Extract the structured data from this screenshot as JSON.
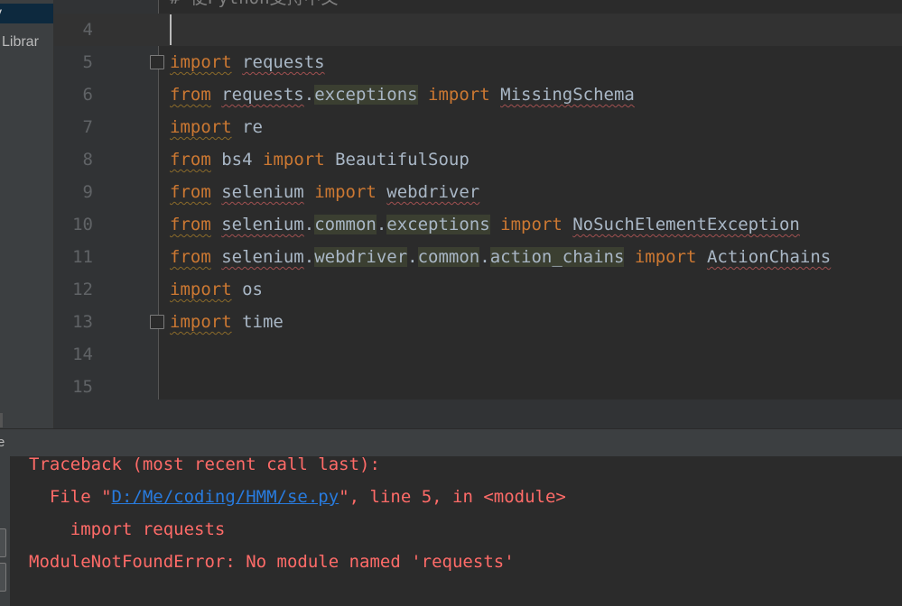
{
  "project_tree": {
    "items": [
      {
        "label": "y",
        "selected": true
      },
      {
        "label": "l Librar",
        "selected": false
      }
    ]
  },
  "editor": {
    "partial_top_line": "# 使Python支持中文",
    "current_line": 4,
    "lines": [
      {
        "num": "4",
        "tokens": []
      },
      {
        "num": "5",
        "fold": "start",
        "tokens": [
          {
            "t": "import",
            "c": "kw wavy-kw"
          },
          {
            "t": " "
          },
          {
            "t": "requests",
            "c": "wavy"
          }
        ]
      },
      {
        "num": "6",
        "tokens": [
          {
            "t": "from",
            "c": "kw wavy-kw"
          },
          {
            "t": " "
          },
          {
            "t": "requests",
            "c": "wavy"
          },
          {
            "t": "."
          },
          {
            "t": "exceptions",
            "c": "hl"
          },
          {
            "t": " "
          },
          {
            "t": "import",
            "c": "kw"
          },
          {
            "t": " "
          },
          {
            "t": "MissingSchema",
            "c": "wavy"
          }
        ]
      },
      {
        "num": "7",
        "tokens": [
          {
            "t": "import",
            "c": "kw wavy-kw"
          },
          {
            "t": " "
          },
          {
            "t": "re"
          }
        ]
      },
      {
        "num": "8",
        "tokens": [
          {
            "t": "from",
            "c": "kw wavy-kw"
          },
          {
            "t": " "
          },
          {
            "t": "bs4"
          },
          {
            "t": " "
          },
          {
            "t": "import",
            "c": "kw"
          },
          {
            "t": " "
          },
          {
            "t": "BeautifulSoup"
          }
        ]
      },
      {
        "num": "9",
        "tokens": [
          {
            "t": "from",
            "c": "kw wavy-kw"
          },
          {
            "t": " "
          },
          {
            "t": "selenium",
            "c": "wavy"
          },
          {
            "t": " "
          },
          {
            "t": "import",
            "c": "kw"
          },
          {
            "t": " "
          },
          {
            "t": "webdriver",
            "c": "wavy"
          }
        ]
      },
      {
        "num": "10",
        "tokens": [
          {
            "t": "from",
            "c": "kw wavy-kw"
          },
          {
            "t": " "
          },
          {
            "t": "selenium",
            "c": "wavy"
          },
          {
            "t": "."
          },
          {
            "t": "common",
            "c": "hl"
          },
          {
            "t": "."
          },
          {
            "t": "exceptions",
            "c": "hl"
          },
          {
            "t": " "
          },
          {
            "t": "import",
            "c": "kw"
          },
          {
            "t": " "
          },
          {
            "t": "NoSuchElementException",
            "c": "wavy"
          }
        ]
      },
      {
        "num": "11",
        "tokens": [
          {
            "t": "from",
            "c": "kw wavy-kw"
          },
          {
            "t": " "
          },
          {
            "t": "selenium",
            "c": "wavy"
          },
          {
            "t": "."
          },
          {
            "t": "webdriver",
            "c": "hl"
          },
          {
            "t": "."
          },
          {
            "t": "common",
            "c": "hl"
          },
          {
            "t": "."
          },
          {
            "t": "action_chains",
            "c": "hl"
          },
          {
            "t": " "
          },
          {
            "t": "import",
            "c": "kw"
          },
          {
            "t": " "
          },
          {
            "t": "ActionChains",
            "c": "wavy"
          }
        ]
      },
      {
        "num": "12",
        "tokens": [
          {
            "t": "import",
            "c": "kw wavy-kw"
          },
          {
            "t": " "
          },
          {
            "t": "os"
          }
        ]
      },
      {
        "num": "13",
        "fold": "end",
        "tokens": [
          {
            "t": "import",
            "c": "kw wavy-kw"
          },
          {
            "t": " "
          },
          {
            "t": "time"
          }
        ]
      },
      {
        "num": "14",
        "tokens": []
      },
      {
        "num": "15",
        "tokens": []
      }
    ]
  },
  "run_panel": {
    "title_fragment": "e",
    "console": {
      "line1": "Traceback (most recent call last):",
      "line2_prefix": "  File \"",
      "line2_link": "D:/Me/coding/HMM/se.py",
      "line2_suffix": "\", line 5, in <module>",
      "line3": "    import requests",
      "line4": "ModuleNotFoundError: No module named 'requests'"
    }
  },
  "colors": {
    "keyword": "#cc7832",
    "identifier": "#a9b7c6",
    "line_number": "#606366",
    "error_text": "#ff6b68",
    "link": "#287bde",
    "editor_bg": "#2b2b2b",
    "panel_bg": "#3c3f41"
  }
}
